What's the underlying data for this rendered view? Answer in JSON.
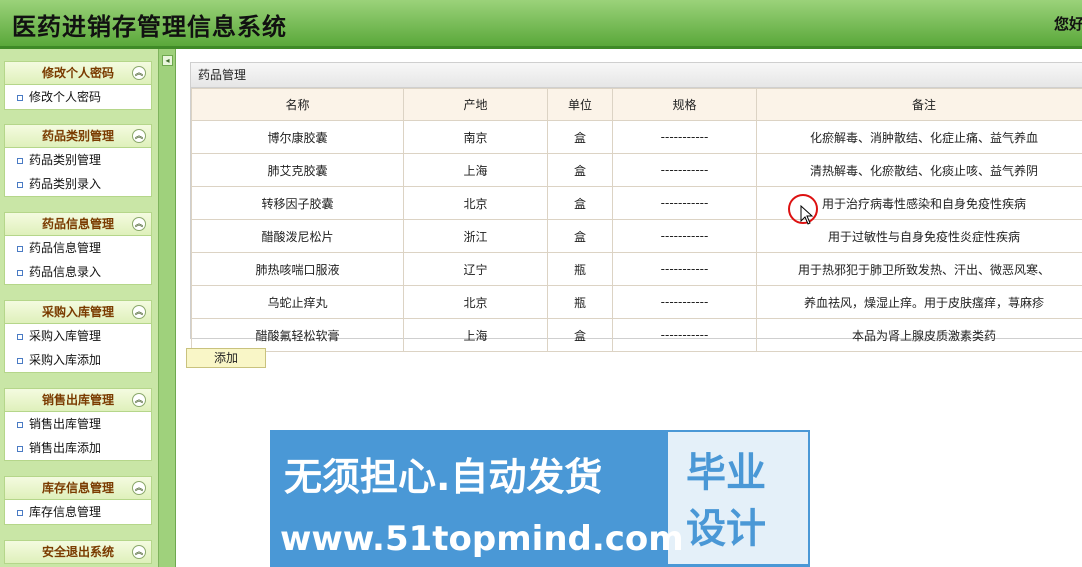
{
  "header": {
    "title": "医药进销存管理信息系统",
    "greeting": "您好"
  },
  "sidebar": {
    "groups": [
      {
        "title": "修改个人密码",
        "items": [
          "修改个人密码"
        ]
      },
      {
        "title": "药品类别管理",
        "items": [
          "药品类别管理",
          "药品类别录入"
        ]
      },
      {
        "title": "药品信息管理",
        "items": [
          "药品信息管理",
          "药品信息录入"
        ]
      },
      {
        "title": "采购入库管理",
        "items": [
          "采购入库管理",
          "采购入库添加"
        ]
      },
      {
        "title": "销售出库管理",
        "items": [
          "销售出库管理",
          "销售出库添加"
        ]
      },
      {
        "title": "库存信息管理",
        "items": [
          "库存信息管理"
        ]
      },
      {
        "title": "安全退出系统",
        "items": []
      }
    ]
  },
  "panel": {
    "title": "药品管理",
    "columns": [
      "名称",
      "产地",
      "单位",
      "规格",
      "备注"
    ],
    "rows": [
      [
        "博尔康胶囊",
        "南京",
        "盒",
        "-----------",
        "化瘀解毒、消肿散结、化症止痛、益气养血"
      ],
      [
        "肺艾克胶囊",
        "上海",
        "盒",
        "-----------",
        "清热解毒、化瘀散结、化痰止咳、益气养阴"
      ],
      [
        "转移因子胶囊",
        "北京",
        "盒",
        "-----------",
        "用于治疗病毒性感染和自身免疫性疾病"
      ],
      [
        "醋酸泼尼松片",
        "浙江",
        "盒",
        "-----------",
        "用于过敏性与自身免疫性炎症性疾病"
      ],
      [
        "肺热咳喘口服液",
        "辽宁",
        "瓶",
        "-----------",
        "用于热邪犯于肺卫所致发热、汗出、微恶风寒、"
      ],
      [
        "乌蛇止痒丸",
        "北京",
        "瓶",
        "-----------",
        "养血祛风，燥湿止痒。用于皮肤瘙痒，荨麻疹"
      ],
      [
        "醋酸氟轻松软膏",
        "上海",
        "盒",
        "-----------",
        "本品为肾上腺皮质激素类药"
      ]
    ],
    "add_label": "添加"
  },
  "watermark": {
    "slogan": "无须担心.自动发货",
    "url": "www.51topmind.com",
    "badge_line1": "毕业",
    "badge_line2": "设计"
  },
  "icons": {
    "collapse": "collapse-up-icon",
    "bullet": "bullet-icon",
    "splitter": "collapse-left-icon"
  }
}
